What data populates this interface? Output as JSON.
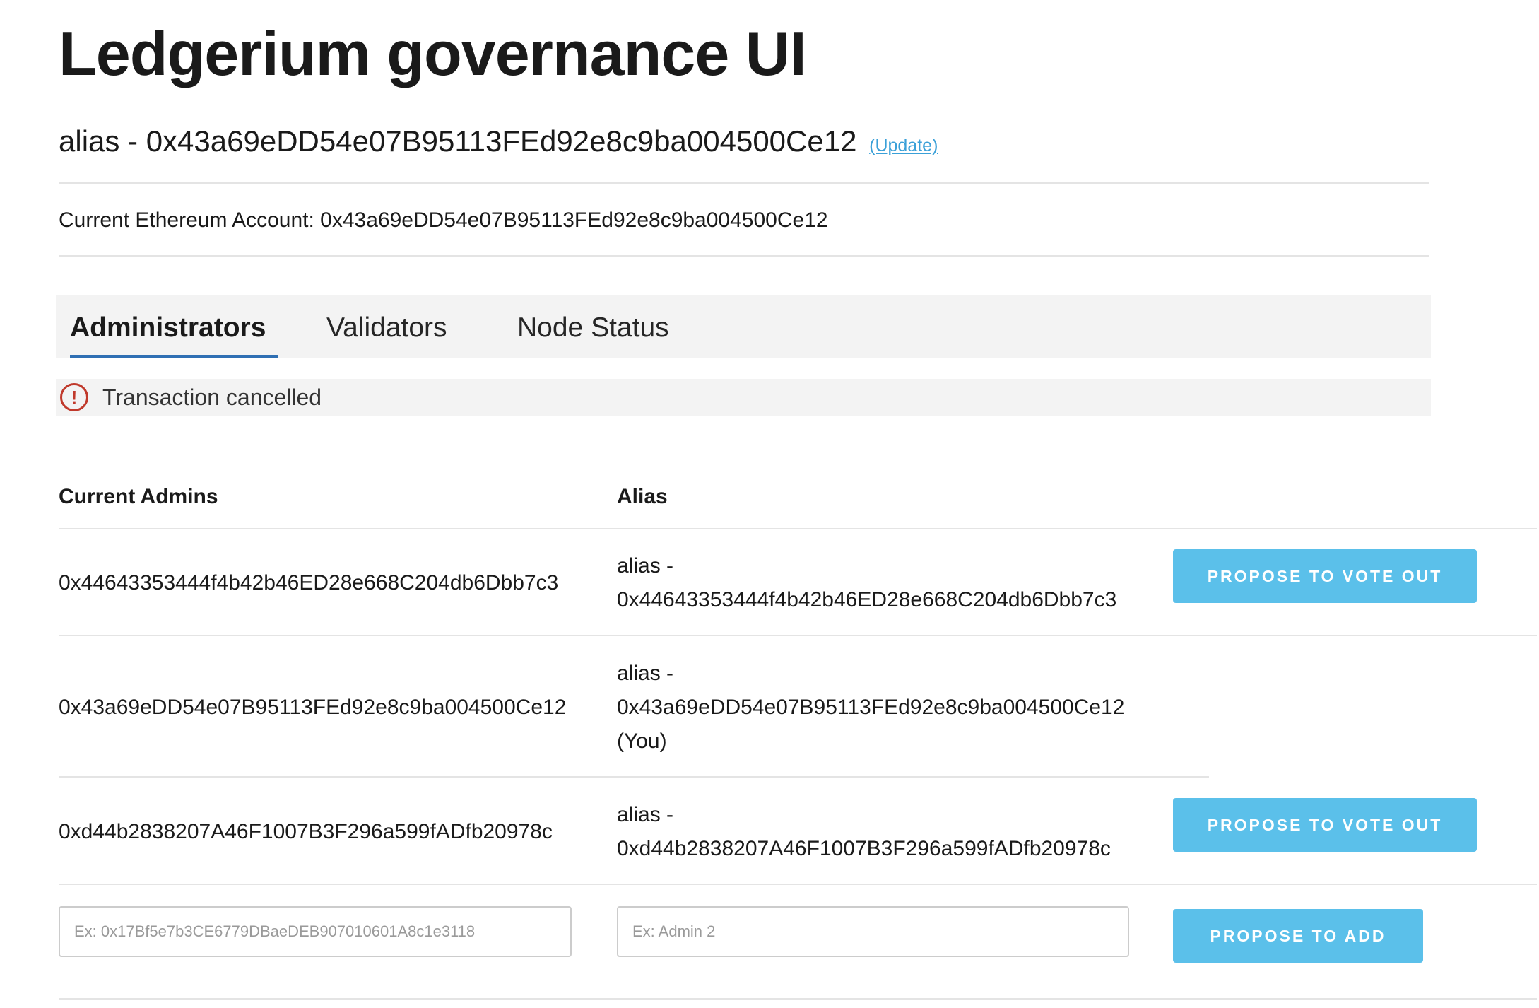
{
  "app": {
    "title": "Ledgerium governance UI",
    "alias_text": "alias - 0x43a69eDD54e07B95113FEd92e8c9ba004500Ce12",
    "update_label": "(Update)",
    "account_text": "Current Ethereum Account: 0x43a69eDD54e07B95113FEd92e8c9ba004500Ce12"
  },
  "tabs": [
    {
      "label": "Administrators",
      "active": true
    },
    {
      "label": "Validators",
      "active": false
    },
    {
      "label": "Node Status",
      "active": false
    }
  ],
  "alert": {
    "icon": "exclamation-circle-icon",
    "icon_glyph": "!",
    "text": "Transaction cancelled",
    "color": "#c0392b"
  },
  "table": {
    "headers": {
      "admins": "Current Admins",
      "alias": "Alias"
    },
    "rows": [
      {
        "address": "0x44643353444f4b42b46ED28e668C204db6Dbb7c3",
        "alias_line1": "alias -",
        "alias_line2": "0x44643353444f4b42b46ED28e668C204db6Dbb7c3",
        "alias_line3": "",
        "action": "PROPOSE TO VOTE OUT"
      },
      {
        "address": "0x43a69eDD54e07B95113FEd92e8c9ba004500Ce12",
        "alias_line1": "alias -",
        "alias_line2": "0x43a69eDD54e07B95113FEd92e8c9ba004500Ce12",
        "alias_line3": "(You)",
        "action": ""
      },
      {
        "address": "0xd44b2838207A46F1007B3F296a599fADfb20978c",
        "alias_line1": "alias -",
        "alias_line2": "0xd44b2838207A46F1007B3F296a599fADfb20978c",
        "alias_line3": "",
        "action": "PROPOSE TO VOTE OUT"
      }
    ],
    "add_row": {
      "address_placeholder": "Ex: 0x17Bf5e7b3CE6779DBaeDEB907010601A8c1e3118",
      "alias_placeholder": "Ex: Admin 2",
      "button_label": "PROPOSE TO ADD"
    }
  },
  "colors": {
    "button_bg": "#5bc0ea",
    "link": "#3aa0d8",
    "tab_underline": "#2f6fb3",
    "panel_bg": "#f3f3f3"
  }
}
